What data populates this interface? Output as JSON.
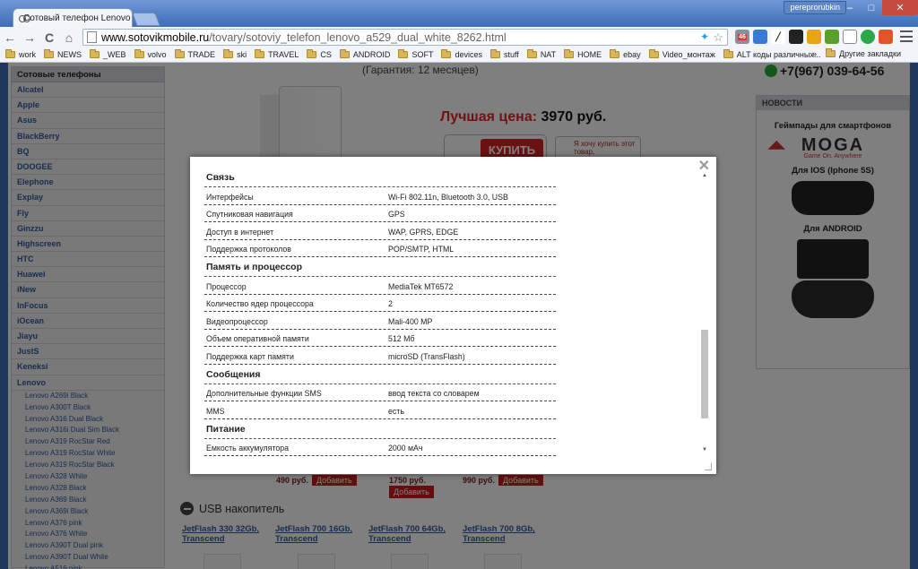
{
  "browser": {
    "tab_title": "Сотовый телефон Lenovo A",
    "tab_close": "×",
    "user_badge": "pereprorubkin",
    "controls": {
      "minimize": "–",
      "maximize": "□",
      "close": "✕"
    },
    "nav": {
      "back": "←",
      "forward": "→",
      "reload": "C",
      "home": "⌂"
    },
    "url_domain": "www.sotovikmobile.ru",
    "url_path": "/tovary/sotoviy_telefon_lenovo_a529_dual_white_8262.html",
    "star": "☆",
    "ext_badge": "46",
    "bookmarks": [
      "work",
      "NEWS",
      "_WEB",
      "volvo",
      "TRADE",
      "ski",
      "TRAVEL",
      "CS",
      "ANDROID",
      "SOFT",
      "devices",
      "stuff",
      "NAT",
      "HOME",
      "ebay",
      "Video_монтаж",
      "ALT коды различных..."
    ],
    "bookmarks_more": "»",
    "other_bookmarks": "Другие закладки"
  },
  "sidebar": {
    "title": "Сотовые телефоны",
    "brands": [
      "Alcatel",
      "Apple",
      "Asus",
      "BlackBerry",
      "BQ",
      "DOOGEE",
      "Elephone",
      "Explay",
      "Fly",
      "Ginzzu",
      "Highscreen",
      "HTC",
      "Huawei",
      "iNew",
      "InFocus",
      "iOcean",
      "Jiayu",
      "JustS",
      "Keneksi",
      "Lenovo"
    ],
    "lenovo_models": [
      "Lenovo A269i Black",
      "Lenovo A300T Black",
      "Lenovo A316 Dual Black",
      "Lenovo A316i Dual Sim Black",
      "Lenovo A319 RocStar Red",
      "Lenovo A319 RocStar White",
      "Lenovo A319 RocStar Black",
      "Lenovo A328 White",
      "Lenovo A328 Black",
      "Lenovo A369 Black",
      "Lenovo A369i Black",
      "Lenovo A376 pink",
      "Lenovo A376 White",
      "Lenovo A390T Dual pink",
      "Lenovo A390T Dual White",
      "Lenovo A516 pink"
    ]
  },
  "product": {
    "warranty": "(Гарантия: 12 месяцев)",
    "best_price_label": "Лучшая цена:",
    "best_price_value": "3970 руб.",
    "buy_label": "КУПИТЬ",
    "want_label": "Я хочу купить этот товар,"
  },
  "related": {
    "prices": [
      "490 руб.",
      "1750 руб.",
      "990 руб."
    ],
    "add_label": "Добавить",
    "usb_title": "USB накопитель",
    "usb_items": [
      "JetFlash 330 32Gb, Transcend",
      "JetFlash 700 16Gb, Transcend",
      "JetFlash 700 64Gb, Transcend",
      "JetFlash 700 8Gb, Transcend"
    ]
  },
  "right": {
    "phone": "+7(967) 039-64-56",
    "news_header": "НОВОСТИ",
    "news_title": "Геймпады для смартфонов",
    "moga_logo": "MOGA",
    "moga_slogan": "Game On. Anywhere",
    "ios_title": "Для IOS (Iphone 5S)",
    "android_title": "Для ANDROID"
  },
  "modal": {
    "close": "✕",
    "sections": [
      {
        "title": "Связь",
        "rows": [
          {
            "k": "Интерфейсы",
            "v": "Wi-Fi 802.11n, Bluetooth 3.0, USB"
          },
          {
            "k": "Спутниковая навигация",
            "v": "GPS"
          },
          {
            "k": "Доступ в интернет",
            "v": "WAP, GPRS, EDGE"
          },
          {
            "k": "Поддержка протоколов",
            "v": "POP/SMTP, HTML"
          }
        ]
      },
      {
        "title": "Память и процессор",
        "rows": [
          {
            "k": "Процессор",
            "v": "MediaTek MT6572"
          },
          {
            "k": "Количество ядер процессора",
            "v": "2"
          },
          {
            "k": "Видеопроцессор",
            "v": "Mali-400 MP"
          },
          {
            "k": "Объем оперативной памяти",
            "v": "512 Мб"
          },
          {
            "k": "Поддержка карт памяти",
            "v": "microSD (TransFlash)"
          }
        ]
      },
      {
        "title": "Сообщения",
        "rows": [
          {
            "k": "Дополнительные функции SMS",
            "v": "ввод текста со словарем"
          },
          {
            "k": "MMS",
            "v": "есть"
          }
        ]
      },
      {
        "title": "Питание",
        "rows": [
          {
            "k": "Емкость аккумулятора",
            "v": "2000 мАч"
          }
        ]
      }
    ],
    "scroll_up": "▲",
    "scroll_down": "▼"
  }
}
